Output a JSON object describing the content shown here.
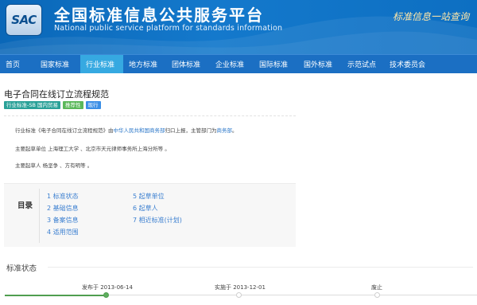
{
  "header": {
    "logo_text": "SAC",
    "title": "全国标准信息公共服务平台",
    "subtitle": "National public service platform  for standards information",
    "slogan": "标准信息一站查询"
  },
  "nav": {
    "items": [
      {
        "label": "首页",
        "active": false
      },
      {
        "label": "国家标准",
        "active": false
      },
      {
        "label": "行业标准",
        "active": true
      },
      {
        "label": "地方标准",
        "active": false
      },
      {
        "label": "团体标准",
        "active": false
      },
      {
        "label": "企业标准",
        "active": false
      },
      {
        "label": "国际标准",
        "active": false
      },
      {
        "label": "国外标准",
        "active": false
      },
      {
        "label": "示范试点",
        "active": false
      },
      {
        "label": "技术委员会",
        "active": false
      }
    ]
  },
  "standard": {
    "title": "电子合同在线订立流程规范",
    "tags": [
      "行业标准-SB 国内贸易",
      "推荐性",
      "现行"
    ]
  },
  "info": {
    "line1_a": "行业标准《电子合同在线订立流程规范》由",
    "line1_link1": "中华人民共和国商务部",
    "line1_b": "归口上报，主管部门为",
    "line1_link2": "商务部",
    "line1_c": "。",
    "line2": "主要起草单位 上海理工大学 、北京市天元律师事务所上海分所等 。",
    "line3": "主要起草人 杨坚争 、方有明等 。"
  },
  "toc": {
    "label": "目录",
    "items": [
      "1 标准状态",
      "2 基础信息",
      "3 备案信息",
      "4 适用范围",
      "5 起草单位",
      "6 起草人",
      "7 相近标准(计划)"
    ]
  },
  "status": {
    "section_title": "标准状态",
    "steps": [
      {
        "label": "发布于 2013-06-14",
        "done": true
      },
      {
        "label": "实施于 2013-12-01",
        "done": false
      },
      {
        "label": "废止",
        "done": false
      }
    ],
    "accent": "#4f9e4f"
  }
}
